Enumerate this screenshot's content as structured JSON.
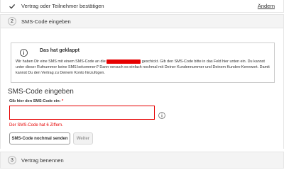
{
  "steps": {
    "step1": {
      "label": "Vertrag oder Teilnehmer bestätigen",
      "edit_label": "Ändern",
      "icon": "check-icon"
    },
    "step2": {
      "number": "2",
      "label": "SMS-Code eingeben"
    },
    "step3": {
      "number": "3",
      "label": "Vertrag benennen"
    }
  },
  "alert": {
    "icon": "info-icon",
    "title": "Das hat geklappt",
    "text_before": "Wir haben Dir eine SMS mit einem SMS-Code an die ",
    "text_after": " geschickt. Gib den SMS-Code bitte in das Feld hier unten ein. Du kannst unter dieser Rufnummer keine SMS bekommen? Dann versuch es einfach nochmal mit Deiner Kundennummer und Deinem Kunden-Kennwort. Damit kannst Du den Vertrag zu Deinem Konto hinzufügen."
  },
  "sms_form": {
    "section_title": "SMS-Code eingeben",
    "field_label": "Gib hier den SMS-Code ein:",
    "required_marker": "*",
    "input_value": "",
    "error_text": "Der SMS-Code hat 6 Ziffern.",
    "resend_label": "SMS-Code nochmal senden",
    "next_label": "Weiter"
  },
  "colors": {
    "accent_red": "#e60000",
    "border_gray": "#e6e6e6"
  }
}
